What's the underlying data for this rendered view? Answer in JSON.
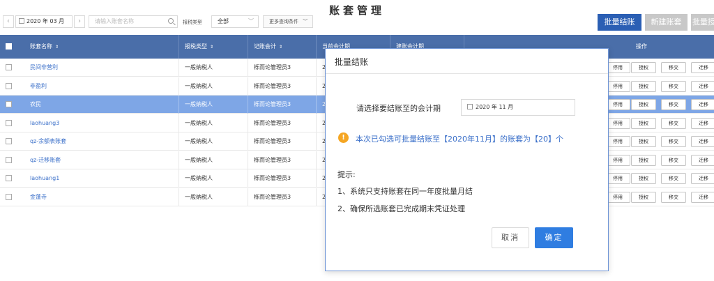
{
  "page_title": "账套管理",
  "toolbar": {
    "prev": "‹",
    "next": "›",
    "period": "2020 年 03 月",
    "search_placeholder": "请输入账套名称",
    "tax_type_label": "报税类型",
    "tax_type_value": "全部",
    "more_filters": "更多查询条件",
    "batch_close": "批量结账",
    "new_account": "新建账套",
    "batch_partial": "批量授"
  },
  "table": {
    "headers": [
      "账套名称",
      "报税类型",
      "记账会计",
      "当前会计期",
      "建账会计期",
      "操作"
    ],
    "rows": [
      {
        "name": "民间非营利",
        "tax": "一般纳税人",
        "accountant": "栎而论管理员3",
        "period": "2"
      },
      {
        "name": "非盈利",
        "tax": "一般纳税人",
        "accountant": "栎而论管理员3",
        "period": "2"
      },
      {
        "name": "农民",
        "tax": "一般纳税人",
        "accountant": "栎而论管理员3",
        "period": "2"
      },
      {
        "name": "laohuang3",
        "tax": "一般纳税人",
        "accountant": "栎而论管理员3",
        "period": "2"
      },
      {
        "name": "qz-余额表账套",
        "tax": "一般纳税人",
        "accountant": "栎而论管理员3",
        "period": "2"
      },
      {
        "name": "qz-迁移账套",
        "tax": "一般纳税人",
        "accountant": "栎而论管理员3",
        "period": "2"
      },
      {
        "name": "laohuang1",
        "tax": "一般纳税人",
        "accountant": "栎而论管理员3",
        "period": "2"
      },
      {
        "name": "金蓬寺",
        "tax": "一般纳税人",
        "accountant": "栎而论管理员3",
        "period": "2"
      }
    ],
    "actions": {
      "disable": "停用",
      "authorize": "授权",
      "transfer": "移交",
      "migrate": "迁移"
    }
  },
  "dialog": {
    "title": "批量结账",
    "period_label": "请选择要结账至的会计期",
    "period_value": "2020 年 11 月",
    "warning": "本次已勾选可批量结账至【2020年11月】的账套为【20】个",
    "tips_title": "提示:",
    "tips": [
      "1、系统只支持账套在同一年度批量月结",
      "2、确保所选账套已完成期末凭证处理"
    ],
    "cancel": "取消",
    "confirm": "确定"
  },
  "colors": {
    "header": "#4a6ea9",
    "primary": "#2b5fb4",
    "selected_row": "#7ea6e6",
    "warning": "#f5a623"
  }
}
